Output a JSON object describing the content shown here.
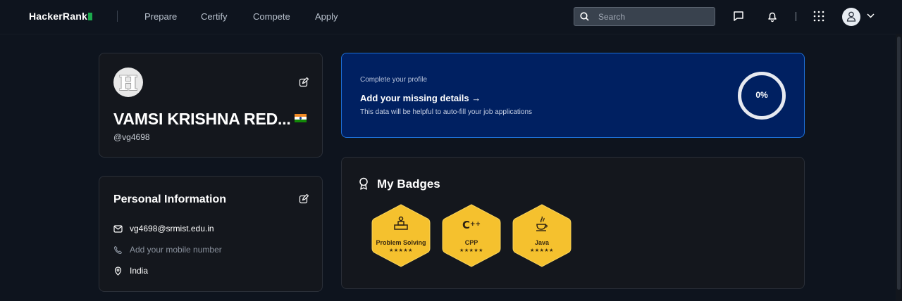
{
  "nav": {
    "logo": "HackerRank",
    "links": [
      "Prepare",
      "Certify",
      "Compete",
      "Apply"
    ],
    "search_placeholder": "Search"
  },
  "profile": {
    "name": "VAMSI KRISHNA RED...",
    "handle": "@vg4698",
    "country_flag": "india-flag-icon"
  },
  "personal_info": {
    "title": "Personal Information",
    "email": "vg4698@srmist.edu.in",
    "mobile_placeholder": "Add your mobile number",
    "location": "India"
  },
  "complete_profile": {
    "label": "Complete your profile",
    "title": "Add your missing details →",
    "description": "This data will be helpful to auto-fill your job applications",
    "progress": "0%"
  },
  "badges": {
    "title": "My Badges",
    "items": [
      {
        "name": "Problem Solving",
        "stars": "★★★★★",
        "icon": "problem-solving-icon"
      },
      {
        "name": "CPP",
        "stars": "★★★★★",
        "icon": "cpp-icon"
      },
      {
        "name": "Java",
        "stars": "★★★★★",
        "icon": "java-icon"
      }
    ]
  },
  "colors": {
    "background": "#0e141e",
    "brand_green": "#1ba94c",
    "profile_banner": "#002061",
    "badge_gold": "#f5c12e"
  }
}
